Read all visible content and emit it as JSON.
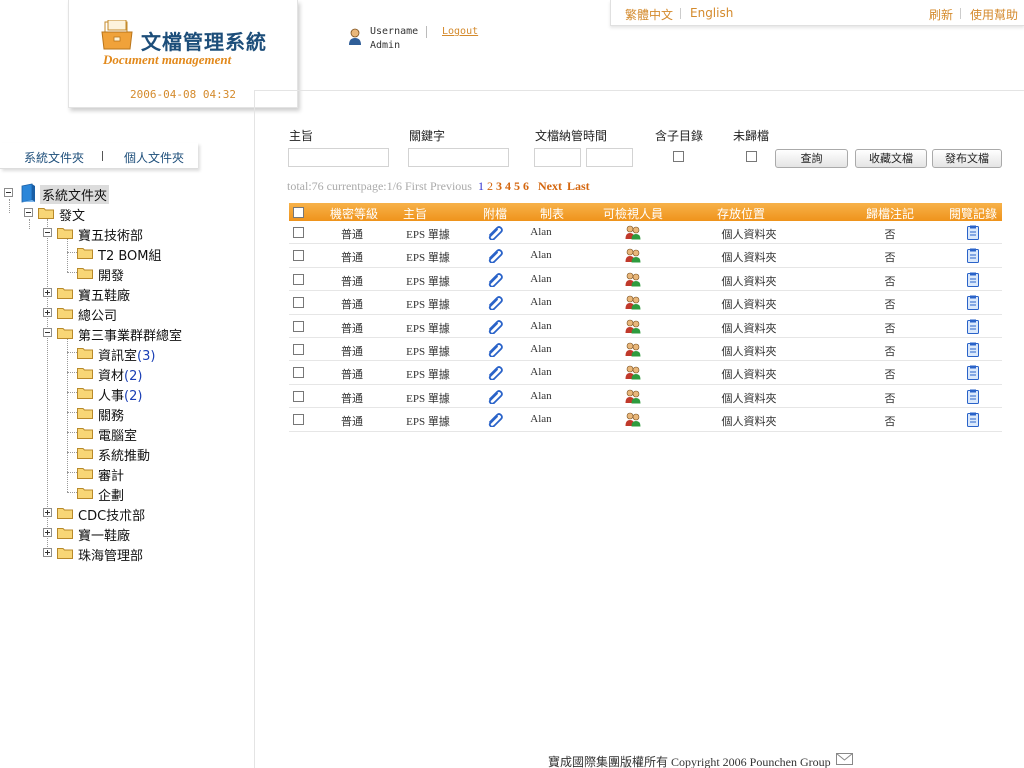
{
  "header": {
    "logo_title": "文檔管理系統",
    "logo_subtitle": "Document management",
    "date": "2006-04-08  04:32",
    "username_label": "Username",
    "user_role": "Admin",
    "logout_label": "Logout",
    "lang_traditional": "繁體中文",
    "lang_english": "English",
    "refresh_label": "刷新",
    "help_label": "使用幫助"
  },
  "folder_tabs": {
    "system": "系統文件夾",
    "personal": "個人文件夾"
  },
  "tree": [
    {
      "label": "系統文件夾",
      "count": ""
    },
    {
      "label": "發文",
      "count": ""
    },
    {
      "label": "寶五技術部",
      "count": ""
    },
    {
      "label": "T2 BOM組",
      "count": ""
    },
    {
      "label": "開發",
      "count": ""
    },
    {
      "label": "寶五鞋廠",
      "count": ""
    },
    {
      "label": "總公司",
      "count": ""
    },
    {
      "label": "第三事業群群總室",
      "count": ""
    },
    {
      "label": "資訊室",
      "count": "(3)"
    },
    {
      "label": "資材",
      "count": "(2)"
    },
    {
      "label": "人事",
      "count": "(2)"
    },
    {
      "label": "關務",
      "count": ""
    },
    {
      "label": "電腦室",
      "count": ""
    },
    {
      "label": "系統推動",
      "count": ""
    },
    {
      "label": "審計",
      "count": ""
    },
    {
      "label": "企劃",
      "count": ""
    },
    {
      "label": "CDC技朮部",
      "count": ""
    },
    {
      "label": "寶一鞋廠",
      "count": ""
    },
    {
      "label": "珠海管理部",
      "count": ""
    }
  ],
  "search": {
    "subject_label": "主旨",
    "keyword_label": "關鍵字",
    "time_label": "文檔納管時間",
    "subdir_label": "含子目錄",
    "unfiled_label": "未歸檔",
    "subject_value": "",
    "keyword_value": "",
    "time_from_value": "",
    "time_to_value": "",
    "query_button": "查詢",
    "favorite_button": "收藏文檔",
    "publish_button": "發布文檔"
  },
  "pager": {
    "info": "total:76 currentpage:1/6 First Previous",
    "pages": [
      "1",
      "2",
      "3",
      "4",
      "5",
      "6"
    ],
    "next": "Next",
    "last": "Last"
  },
  "table": {
    "headers": [
      "機密等級",
      "主旨",
      "附檔",
      "制表",
      "可檢視人員",
      "存放位置",
      "歸檔注記",
      "閱覽記錄"
    ],
    "rows": [
      {
        "level": "普通",
        "subject": "EPS 單據",
        "author": "Alan",
        "location": "個人資料夾",
        "filed": "否"
      },
      {
        "level": "普通",
        "subject": "EPS 單據",
        "author": "Alan",
        "location": "個人資料夾",
        "filed": "否"
      },
      {
        "level": "普通",
        "subject": "EPS 單據",
        "author": "Alan",
        "location": "個人資料夾",
        "filed": "否"
      },
      {
        "level": "普通",
        "subject": "EPS 單據",
        "author": "Alan",
        "location": "個人資料夾",
        "filed": "否"
      },
      {
        "level": "普通",
        "subject": "EPS 單據",
        "author": "Alan",
        "location": "個人資料夾",
        "filed": "否"
      },
      {
        "level": "普通",
        "subject": "EPS 單據",
        "author": "Alan",
        "location": "個人資料夾",
        "filed": "否"
      },
      {
        "level": "普通",
        "subject": "EPS 單據",
        "author": "Alan",
        "location": "個人資料夾",
        "filed": "否"
      },
      {
        "level": "普通",
        "subject": "EPS 單據",
        "author": "Alan",
        "location": "個人資料夾",
        "filed": "否"
      },
      {
        "level": "普通",
        "subject": "EPS 單據",
        "author": "Alan",
        "location": "個人資料夾",
        "filed": "否"
      }
    ]
  },
  "footer": {
    "copyright": "寶成國際集團版權所有  Copyright 2006 Pounchen Group"
  },
  "colors": {
    "accent_orange": "#ef931b",
    "brand_blue": "#1d4e7a",
    "link_orange": "#d48a2c"
  }
}
